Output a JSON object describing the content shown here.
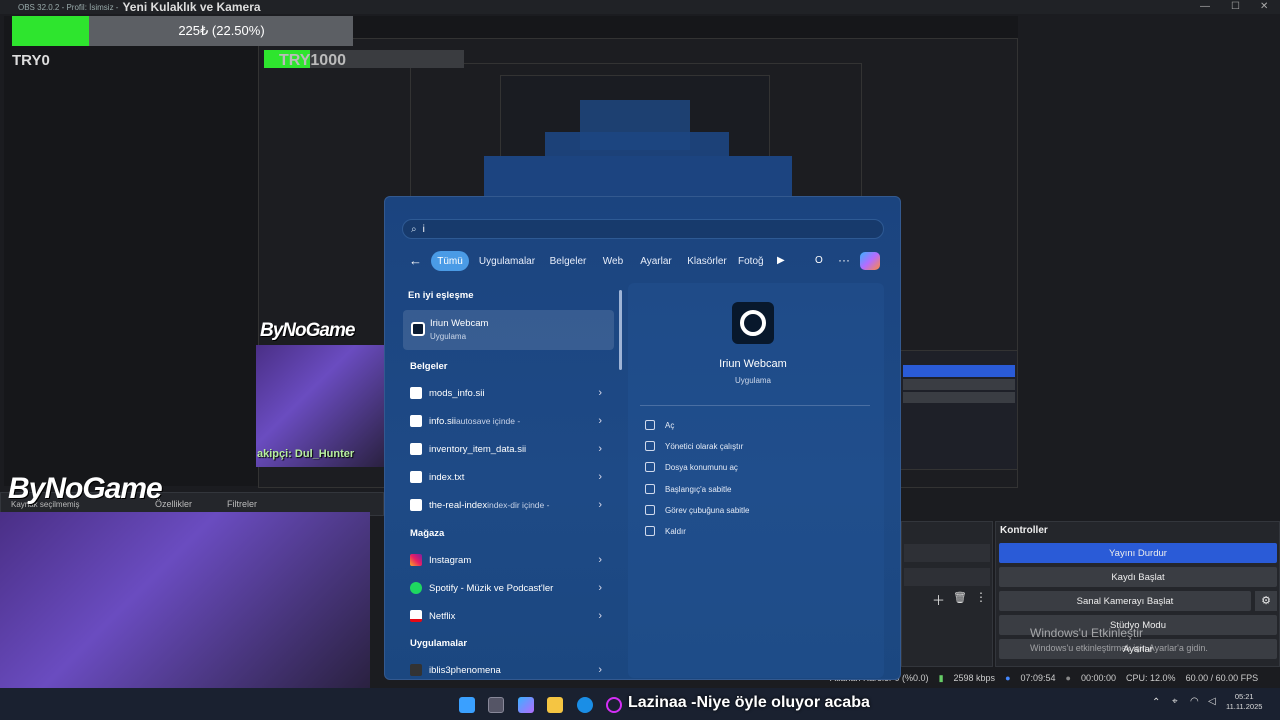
{
  "obs": {
    "title_prefix": "OBS 32.0.2 - Profil: İsimsiz -",
    "scene_name": "Yeni Kulaklık ve Kamera",
    "win_min": "—",
    "win_max": "☐",
    "win_close": "✕"
  },
  "overlay": {
    "donation_text": "225₺ (22.50%)",
    "donation_progress": 0.225,
    "left_label": "TRY0",
    "right_label": "TRY1000",
    "brand": "ByNoGame",
    "ticker": "akipçi: Dul_Hunter"
  },
  "start_menu": {
    "search_value": "i",
    "chips": [
      "Tümü",
      "Uygulamalar",
      "Belgeler",
      "Web",
      "Ayarlar",
      "Klasörler",
      "Fotoğ"
    ],
    "chip_o": "O",
    "chip_more": "···",
    "best_match_heading": "En iyi eşleşme",
    "best_match": {
      "title": "Iriun Webcam",
      "subtitle": "Uygulama"
    },
    "documents_heading": "Belgeler",
    "documents": [
      {
        "name": "mods_info.sii",
        "detail": ""
      },
      {
        "name": "info.sii",
        "detail": "autosave içinde -"
      },
      {
        "name": "inventory_item_data.sii",
        "detail": ""
      },
      {
        "name": "index.txt",
        "detail": ""
      },
      {
        "name": "the-real-index",
        "detail": "index-dir içinde -"
      }
    ],
    "store_heading": "Mağaza",
    "store": [
      {
        "name": "Instagram"
      },
      {
        "name": "Spotify - Müzik ve Podcast'ler"
      },
      {
        "name": "Netflix"
      }
    ],
    "apps_heading": "Uygulamalar",
    "apps": [
      {
        "name": "iblis3phenomena"
      }
    ],
    "preview": {
      "title": "Iriun Webcam",
      "subtitle": "Uygulama"
    },
    "actions": [
      "Aç",
      "Yönetici olarak çalıştır",
      "Dosya konumunu aç",
      "Başlangıç'a sabitle",
      "Görev çubuğuna sabitle",
      "Kaldır"
    ]
  },
  "obs_docks": {
    "source_selection": "Kaynak seçilmemiş",
    "properties_label": "Özellikler",
    "filters_label": "Filtreler",
    "controls_title": "Kontroller",
    "buttons": [
      "Yayını Durdur",
      "Kaydı Başlat",
      "Sanal Kamerayı Başlat",
      "Stüdyo Modu",
      "Ayarlar"
    ],
    "activation_title": "Windows'u Etkinleştir",
    "activation_sub": "Windows'u etkinleştirmek için Ayarlar'a gidin."
  },
  "status": {
    "dropped": "Atlanan Kareler 0 (%0.0)",
    "bitrate": "2598 kbps",
    "live_time": "07:09:54",
    "rec_time": "00:00:00",
    "cpu": "CPU: 12.0%",
    "fps": "60.00 / 60.00 FPS"
  },
  "taskbar": {
    "subtitle": "Lazinaa -Niye öyle oluyor acaba",
    "time": "05:21",
    "date": "11.11.2025"
  },
  "colors": {
    "accent_green": "#2ee52e",
    "stream_btn": "#2a5bd7",
    "start_bg": "#1d4785"
  }
}
